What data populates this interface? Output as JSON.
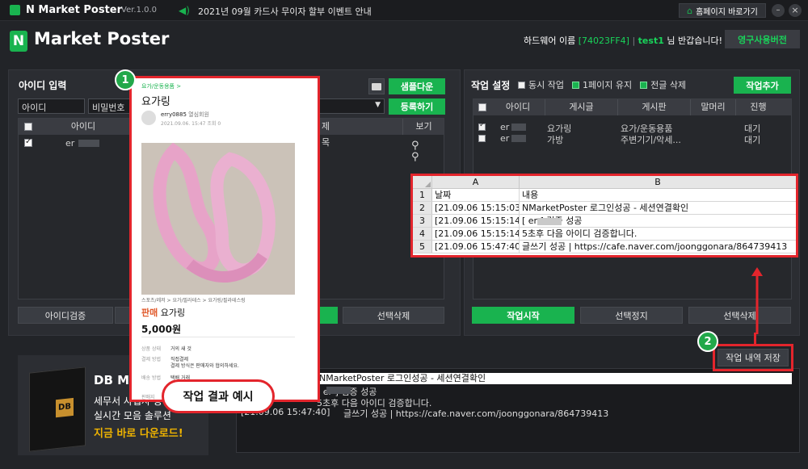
{
  "titlebar": {
    "app_name": "N Market Poster",
    "version": "Ver.1.0.0",
    "notice": "2021년 09월 카드사 무이자 할부 이벤트 안내",
    "home_button": "홈페이지 바로가기",
    "minimize": "–",
    "close": "×"
  },
  "header": {
    "logo_text": "Market Poster",
    "hw_label": "하드웨어 이름",
    "hw_id": "[74023FF4]",
    "user": "test1",
    "greeting": "님 반갑습니다!",
    "license_button": "영구사용버전"
  },
  "id_panel": {
    "title": "아이디 입력",
    "id_placeholder": "아이디",
    "pw_placeholder": "비밀번호",
    "col_id": "아이디",
    "rows": [
      {
        "id": "er"
      }
    ],
    "verify_button": "아이디검증"
  },
  "post_panel": {
    "sample_button": "샘플다운",
    "register_button": "등록하기",
    "col_title": "제목",
    "col_view": "보기",
    "delete_button": "선택삭제"
  },
  "task_panel": {
    "title": "작업 설정",
    "opt_concurrent": "동시 작업",
    "opt_keep_page": "1페이지 유지",
    "opt_delete_all": "전글 삭제",
    "add_button": "작업추가",
    "columns": [
      "아이디",
      "게시글",
      "게시판",
      "말머리",
      "진행"
    ],
    "rows": [
      {
        "id": "er",
        "post": "요가링",
        "board": "요가/운동용품",
        "status": "대기"
      },
      {
        "id": "er",
        "post": "가방",
        "board": "주변기기/악세...",
        "status": "대기"
      }
    ],
    "start_button": "작업시작",
    "stop_button": "선택정지",
    "delete_button": "선택삭제",
    "save_button": "작업 내역 저장"
  },
  "excel": {
    "col_a": "A",
    "col_b": "B",
    "rows": [
      {
        "n": "1",
        "a": "날짜",
        "b": "내용"
      },
      {
        "n": "2",
        "a": "[21.09.06 15:15:03]",
        "b": "NMarketPoster 로그인성공 - 세션연결확인"
      },
      {
        "n": "3",
        "a": "[21.09.06 15:15:14]",
        "b": "[ er      ] 검증 성공"
      },
      {
        "n": "4",
        "a": "[21.09.06 15:15:14]",
        "b": "5초후 다음 아이디 검증합니다."
      },
      {
        "n": "5",
        "a": "[21.09.06 15:47:40]",
        "b": "글쓰기 성공 | https://cafe.naver.com/joonggonara/864739413"
      }
    ]
  },
  "log": {
    "lines": [
      "NMarketPoster 로그인성공 - 세션연결확인",
      "[ er      ] 검증 성공",
      "5초후 다음 아이디 검증합니다.",
      "글쓰기 성공 | https://cafe.naver.com/joonggonara/864739413"
    ],
    "last_time": "[21.09.06 15:47:40]"
  },
  "ad": {
    "title": "DB MA",
    "line1": "세무서 사업자 등록",
    "line2": "실시간 모음 솔루션",
    "cta": "지금 바로 다운로드!",
    "box_logo": "DB"
  },
  "preview": {
    "breadcrumb": "요가/운동용품 >",
    "title": "요가링",
    "author": "erry0885",
    "author_tag": "열심회원",
    "meta": "2021.09.06. 15:47  조회 0",
    "category": "스포츠/레저 > 요가/필라테스 > 요가링/필라테스링",
    "sale_tag": "판매",
    "item": "요가링",
    "price": "5,000원",
    "cond_label": "상품 상태",
    "cond_value": "거의 새 것",
    "pay_label": "결제 방법",
    "pay_value": "직접결제",
    "pay_note": "결제 방식은 판매자와 협의하세요.",
    "ship_label": "배송 방법",
    "ship_value": "택배 거래",
    "area_label": "판매지",
    "caption": "작업 결과 예시"
  },
  "badges": {
    "one": "1",
    "two": "2"
  },
  "colors": {
    "accent": "#19b34f",
    "highlight": "#e3252c",
    "bg": "#222428",
    "panel": "#2b2d32"
  }
}
